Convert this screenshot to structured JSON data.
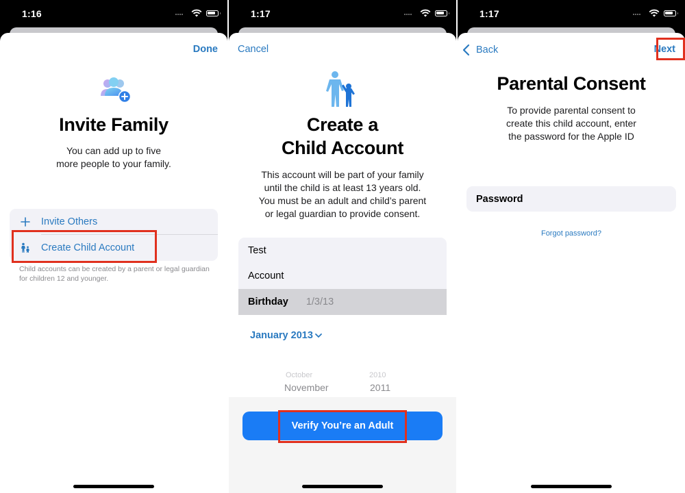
{
  "screens": [
    {
      "status": {
        "time": "1:16"
      },
      "nav": {
        "right": "Done"
      },
      "icon": "family-add-icon",
      "title": "Invite Family",
      "description_lines": [
        "You can add up to five",
        "more people to your family."
      ],
      "options": [
        {
          "icon": "plus-icon",
          "label": "Invite Others"
        },
        {
          "icon": "child-account-icon",
          "label": "Create Child Account",
          "highlighted": true
        }
      ],
      "footnote": "Child accounts can be created by a parent or legal guardian for children 12 and younger."
    },
    {
      "status": {
        "time": "1:17"
      },
      "nav": {
        "left": "Cancel"
      },
      "icon": "parent-child-icon",
      "title_lines": [
        "Create a",
        "Child Account"
      ],
      "description_lines": [
        "This account will be part of your family",
        "until the child is at least 13 years old.",
        "You must be an adult and child’s parent",
        "or legal guardian to provide consent."
      ],
      "form": {
        "first_name": "Test",
        "last_name": "Account",
        "birthday_label": "Birthday",
        "birthday_value": "1/3/13"
      },
      "month_picker": "January 2013",
      "wheel": {
        "faint": {
          "month": "October",
          "year": "2010"
        },
        "near": {
          "month": "November",
          "year": "2011"
        }
      },
      "primary_button": "Verify You’re an Adult",
      "highlight": "primary_button"
    },
    {
      "status": {
        "time": "1:17"
      },
      "nav": {
        "left": "Back",
        "right": "Next",
        "highlight": "right"
      },
      "title": "Parental Consent",
      "description_lines": [
        "To provide parental consent to",
        "create this child account, enter",
        "the password for the Apple ID"
      ],
      "password_placeholder": "Password",
      "forgot_link": "Forgot password?"
    }
  ],
  "colors": {
    "accent": "#2a7ac0",
    "primary_button": "#1a7cf5",
    "highlight_border": "#e0301e",
    "grouped_bg": "#f2f2f7"
  }
}
